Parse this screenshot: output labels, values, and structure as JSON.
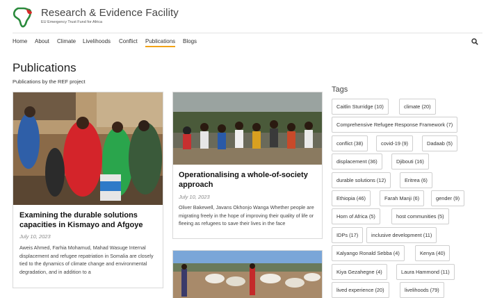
{
  "brand": {
    "title": "Research & Evidence Facility",
    "subtitle": "EU Emergency Trust Fund for Africa"
  },
  "nav": {
    "items": [
      "Home",
      "About",
      "Climate",
      "Livelihoods",
      "Conflict",
      "Publications",
      "Blogs"
    ],
    "active": "Publications",
    "accent_color": "#f2a316"
  },
  "page": {
    "title": "Publications",
    "subtitle": "Publications by the REF project"
  },
  "cards": [
    {
      "title": "Examining the durable solutions capacities in Kismayo and Afgoye",
      "date": "July 10, 2023",
      "text": "Aweis Ahmed, Farhia Mohamud, Mahad Wasuge Internal displacement and refugee repatriation in Somalia are closely tied to the dynamics of climate change and environmental degradation, and in addition to a"
    },
    {
      "title": "Operationalising a whole-of-society approach",
      "date": "July 10, 2023",
      "text": "Oliver Bakewell, Javans Okhonjo Wanga Whether people are migrating freely in the hope of improving their quality of life or fleeing as refugees to save their lives in the face"
    },
    {
      "title": "",
      "date": "",
      "text": ""
    }
  ],
  "tags": {
    "heading": "Tags",
    "items": [
      "Caitlin Sturridge (10)",
      "climate (20)",
      "Comprehensive Refugee Response Framework (7)",
      "conflict (38)",
      "covid-19 (9)",
      "Dadaab (5)",
      "displacement (36)",
      "Djibouti (16)",
      "durable solutions (12)",
      "Eritrea (6)",
      "Ethiopia (46)",
      "Farah Manji (6)",
      "gender (9)",
      "Horn of Africa (5)",
      "host communities (5)",
      "IDPs (17)",
      "inclusive development (11)",
      "Kalyango Ronald Sebba (4)",
      "Kenya (40)",
      "Kiya Gezahegne (4)",
      "Laura Hammond (11)",
      "lived experience (20)",
      "livelihoods (79)"
    ]
  }
}
